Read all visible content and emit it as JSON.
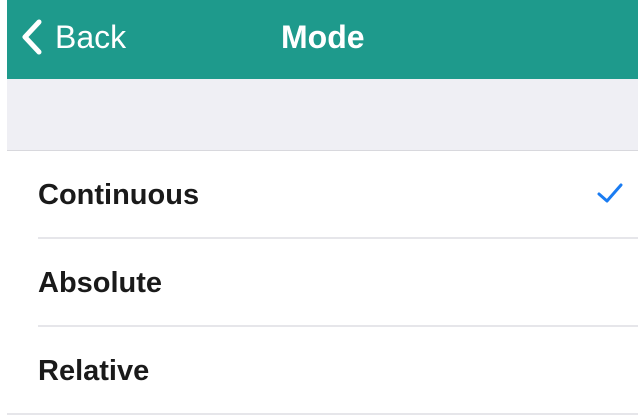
{
  "navbar": {
    "back_label": "Back",
    "back_icon": "chevron-left-icon",
    "title": "Mode",
    "background_color": "#1e9a8c"
  },
  "mode_list": {
    "items": [
      {
        "label": "Continuous",
        "selected": true
      },
      {
        "label": "Absolute",
        "selected": false
      },
      {
        "label": "Relative",
        "selected": false
      }
    ],
    "check_icon": "checkmark-icon",
    "check_color": "#1a7cf2"
  }
}
